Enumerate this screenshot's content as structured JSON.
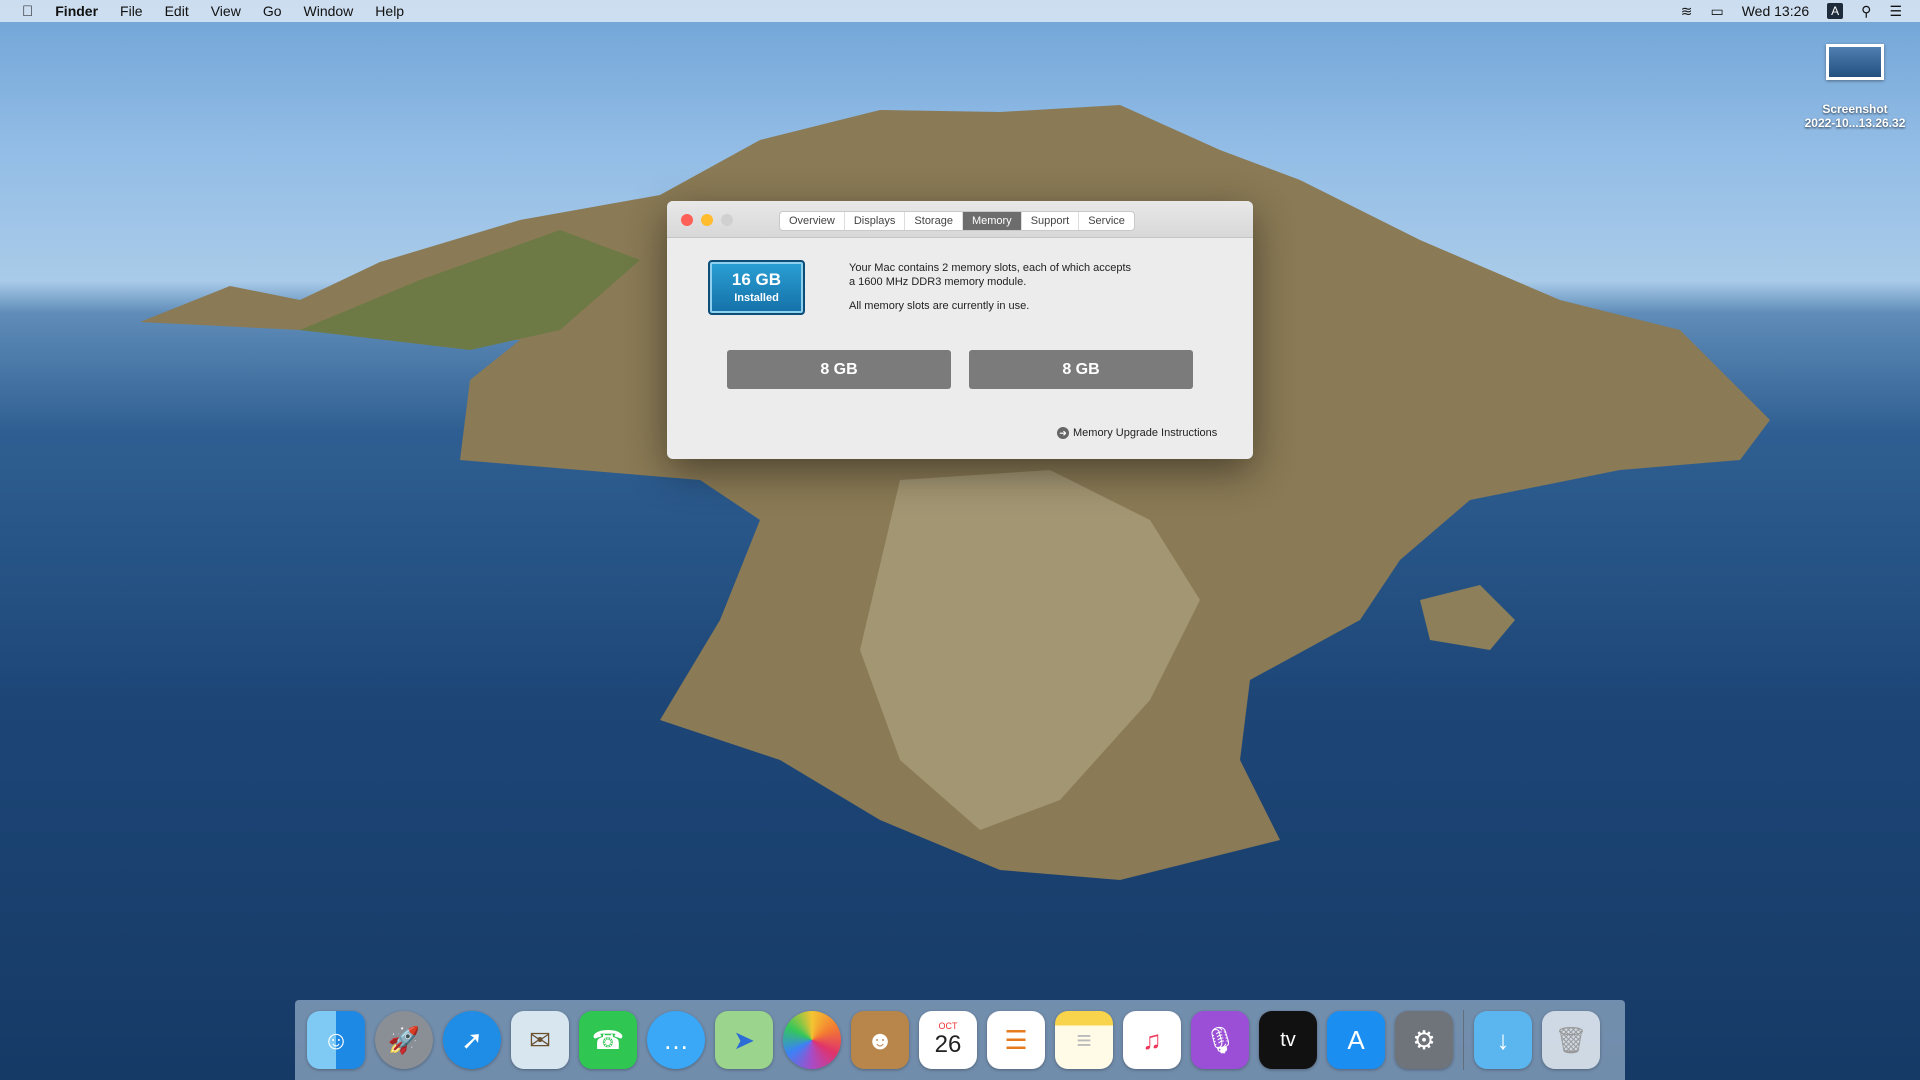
{
  "menubar": {
    "app": "Finder",
    "items": [
      "File",
      "Edit",
      "View",
      "Go",
      "Window",
      "Help"
    ],
    "clock": "Wed 13:26",
    "input_source": "A"
  },
  "desktop": {
    "file_name": "Screenshot",
    "file_date": "2022-10...13.26.32"
  },
  "window": {
    "tabs": [
      "Overview",
      "Displays",
      "Storage",
      "Memory",
      "Support",
      "Service"
    ],
    "active_tab": "Memory",
    "total": "16 GB",
    "total_label": "Installed",
    "desc1": "Your Mac contains 2 memory slots, each of which accepts",
    "desc2": "a 1600 MHz DDR3 memory module.",
    "desc3": "All memory slots are currently in use.",
    "slots": [
      "8 GB",
      "8 GB"
    ],
    "upgrade_link": "Memory Upgrade Instructions"
  },
  "dock": {
    "calendar_month": "OCT",
    "calendar_day": "26",
    "tv_label": "tv"
  },
  "colors": {
    "installed_box": "#1a84c0",
    "slot": "#7b7b7b",
    "close": "#fe5f57",
    "minimize": "#febc2e"
  }
}
